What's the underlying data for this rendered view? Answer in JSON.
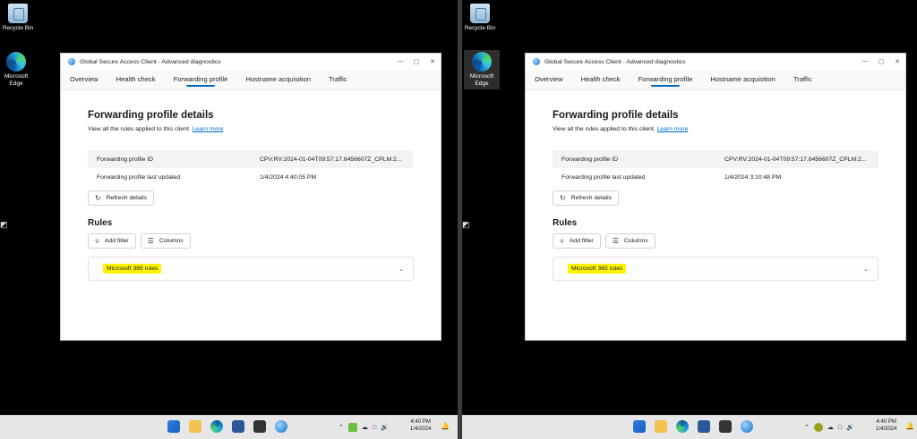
{
  "desktop": {
    "recycle_bin_label": "Recycle Bin",
    "edge_label_line1": "Microsoft",
    "edge_label_line2": "Edge"
  },
  "window": {
    "title": "Global Secure Access Client - Advanced diagnostics",
    "tabs": [
      "Overview",
      "Health check",
      "Forwarding profile",
      "Hostname acquisition",
      "Traffic"
    ],
    "active_tab": "Forwarding profile",
    "heading": "Forwarding profile details",
    "description": "View all the rules applied to this client.",
    "learn_more": "Learn more",
    "profile_id_label": "Forwarding profile ID",
    "profile_id_value": "CPV:RV:2024-01-04T09:57:17.6456607Z_CPLM:2...",
    "last_updated_label": "Forwarding profile last updated",
    "refresh_label": "Refresh details",
    "rules_heading": "Rules",
    "add_filter_label": "Add filter",
    "columns_label": "Columns",
    "rule_name": "Microsoft 365 rules"
  },
  "left": {
    "last_updated_value": "1/4/2024 4:40:05 PM",
    "clock_time": "4:40 PM",
    "clock_date": "1/4/2024"
  },
  "right": {
    "last_updated_value": "1/4/2024 3:10:48 PM",
    "clock_time": "4:40 PM",
    "clock_date": "1/4/2024"
  },
  "colors": {
    "accent": "#0067c0",
    "highlight": "#fff200",
    "taskbar": "#e6e6e6"
  },
  "icons": [
    "recycle-bin-icon",
    "edge-icon",
    "windows-start-icon",
    "file-explorer-icon",
    "store-icon",
    "terminal-icon",
    "globe-icon",
    "chevron-up-icon",
    "wifi-icon",
    "volume-icon",
    "bell-icon",
    "refresh-icon",
    "filter-icon",
    "columns-icon",
    "chevron-down-icon"
  ]
}
